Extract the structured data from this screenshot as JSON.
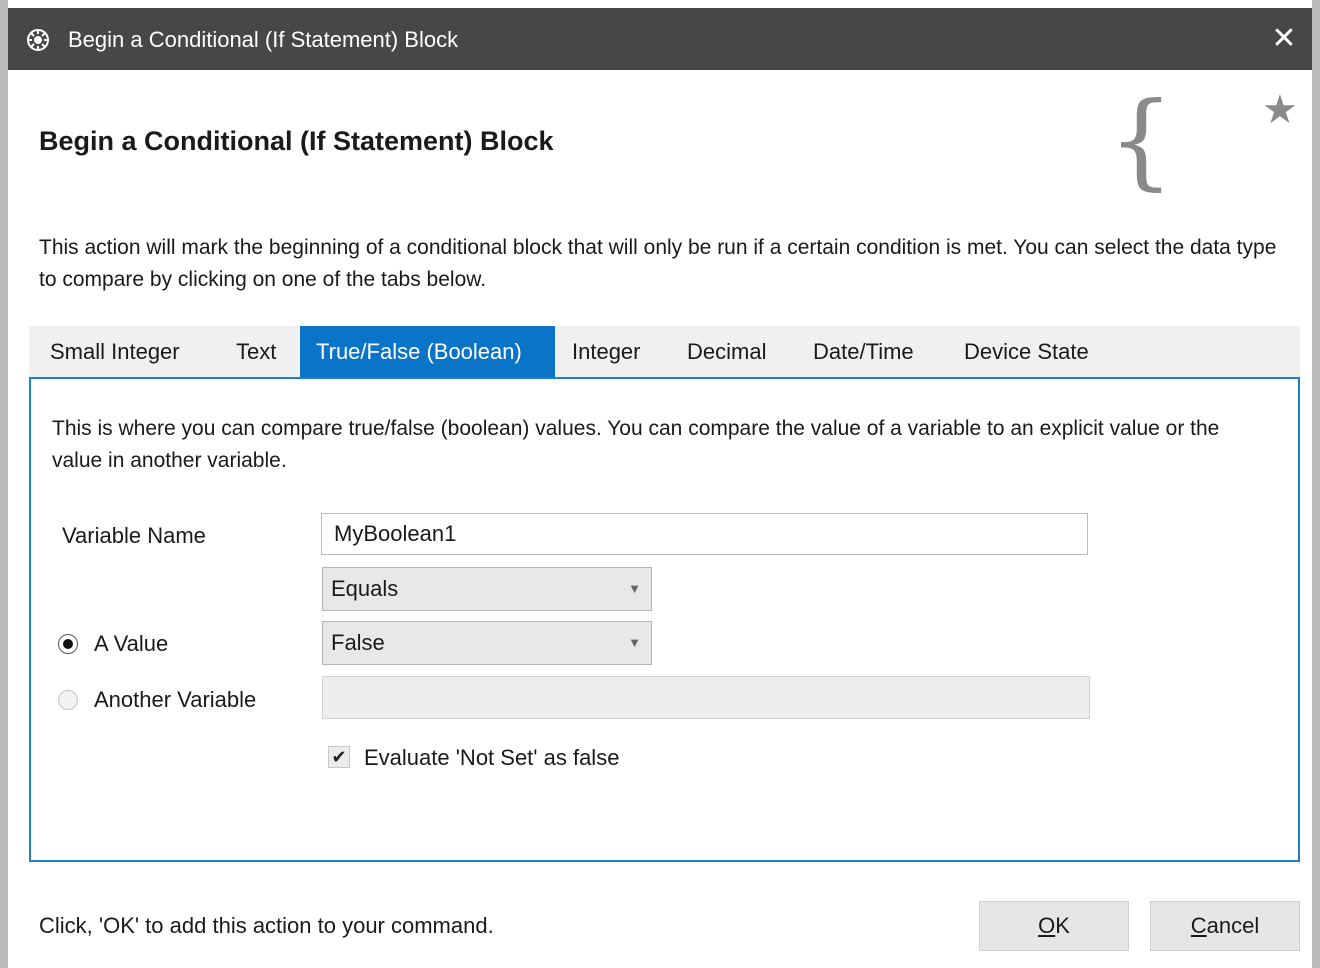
{
  "window": {
    "title": "Begin a Conditional (If Statement) Block",
    "close_symbol": "✕"
  },
  "header": {
    "heading": "Begin a Conditional (If Statement) Block",
    "brace_symbol": "{",
    "star_symbol": "★"
  },
  "description": "This action will mark the beginning of a conditional block that will only be run if a certain condition is met.  You can select the data type to compare by clicking on one of the tabs below.",
  "tabs": [
    {
      "label": "Small Integer",
      "active": false
    },
    {
      "label": "Text",
      "active": false
    },
    {
      "label": "True/False (Boolean)",
      "active": true
    },
    {
      "label": "Integer",
      "active": false
    },
    {
      "label": "Decimal",
      "active": false
    },
    {
      "label": "Date/Time",
      "active": false
    },
    {
      "label": "Device State",
      "active": false
    }
  ],
  "panel": {
    "description": "This is where you can compare true/false (boolean) values.  You can compare the value of a variable to an explicit value or the value in another variable.",
    "variable_name_label": "Variable Name",
    "variable_name_value": "MyBoolean1",
    "operator_selected": "Equals",
    "a_value_label": "A Value",
    "a_value_selected": "False",
    "another_variable_label": "Another Variable",
    "another_variable_value": "",
    "evaluate_checkbox_label": "Evaluate 'Not Set' as false",
    "evaluate_checked": true,
    "dropdown_arrow": "▼",
    "check_mark": "✔"
  },
  "footer": {
    "hint": "Click, 'OK' to add this action to your command.",
    "ok_mnemonic": "O",
    "ok_rest": "K",
    "cancel_mnemonic": "C",
    "cancel_rest": "ancel"
  },
  "colors": {
    "titlebar": "#474747",
    "accent": "#0a74c9"
  }
}
